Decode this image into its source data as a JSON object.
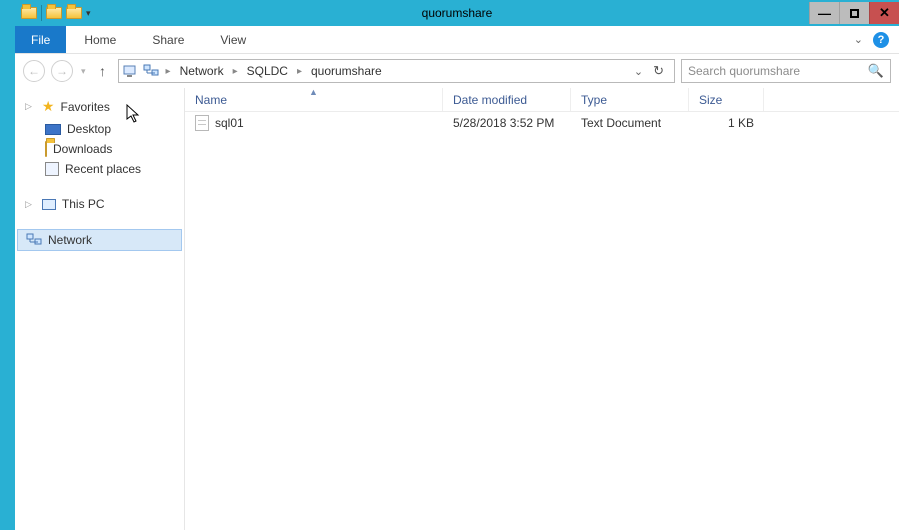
{
  "titlebar": {
    "title": "quorumshare"
  },
  "ribbon": {
    "file": "File",
    "tabs": [
      "Home",
      "Share",
      "View"
    ]
  },
  "address": {
    "crumbs": [
      "Network",
      "SQLDC",
      "quorumshare"
    ]
  },
  "search": {
    "placeholder": "Search quorumshare"
  },
  "sidebar": {
    "favorites_label": "Favorites",
    "favorites": [
      {
        "label": "Desktop",
        "icon": "desktop"
      },
      {
        "label": "Downloads",
        "icon": "downloads"
      },
      {
        "label": "Recent places",
        "icon": "recent"
      }
    ],
    "this_pc": "This PC",
    "network": "Network"
  },
  "columns": {
    "name": "Name",
    "date": "Date modified",
    "type": "Type",
    "size": "Size"
  },
  "rows": [
    {
      "name": "sql01",
      "date": "5/28/2018 3:52 PM",
      "type": "Text Document",
      "size": "1 KB"
    }
  ]
}
